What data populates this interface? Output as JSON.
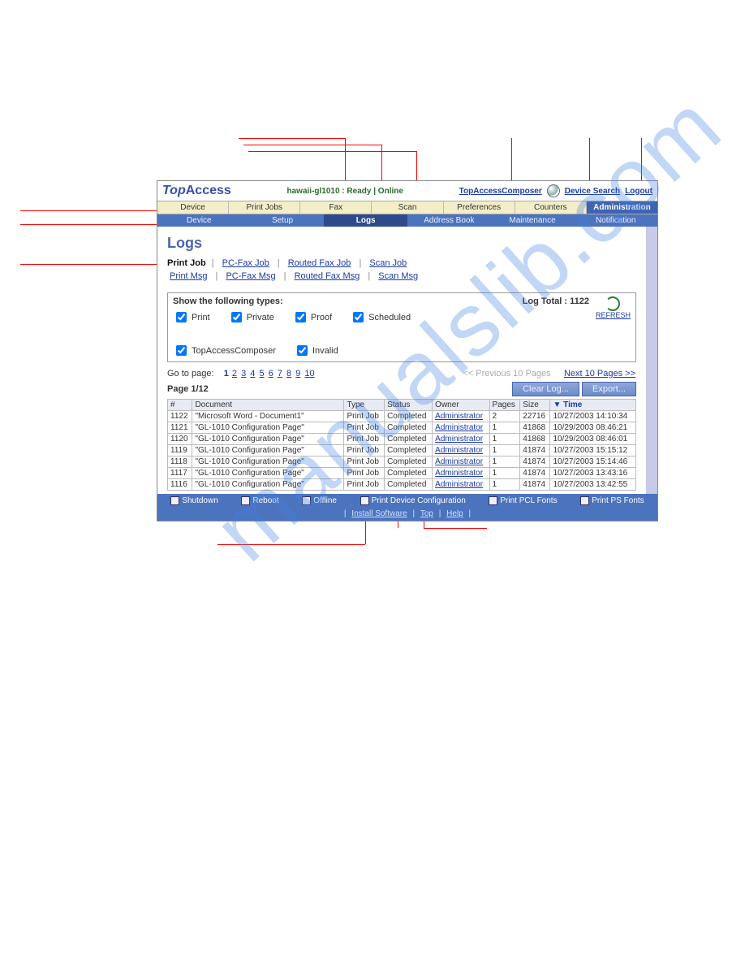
{
  "header": {
    "logo_prefix": "Top",
    "logo_suffix": "Access",
    "device_status": "hawaii-gl1010 : Ready | Online",
    "composer_link": "TopAccessComposer",
    "device_search": "Device Search",
    "logout": "Logout"
  },
  "main_tabs": [
    "Device",
    "Print Jobs",
    "Fax",
    "Scan",
    "Preferences",
    "Counters",
    "Administration"
  ],
  "sub_tabs": [
    "Device",
    "Setup",
    "Logs",
    "Address Book",
    "Maintenance",
    "Notification"
  ],
  "page_title": "Logs",
  "job_links": {
    "current": "Print Job",
    "others": [
      "PC-Fax Job",
      "Routed Fax Job",
      "Scan Job"
    ]
  },
  "msg_links": [
    "Print Msg",
    "PC-Fax Msg",
    "Routed Fax Msg",
    "Scan Msg"
  ],
  "filter": {
    "title": "Show the following types:",
    "options": [
      "Print",
      "Private",
      "Proof",
      "Scheduled",
      "TopAccessComposer",
      "Invalid"
    ],
    "total_label": "Log Total :",
    "total_value": "1122",
    "refresh": "REFRESH"
  },
  "pager": {
    "goto": "Go to page:",
    "pages": [
      "1",
      "2",
      "3",
      "4",
      "5",
      "6",
      "7",
      "8",
      "9",
      "10"
    ],
    "prev": "<< Previous 10 Pages",
    "next": "Next 10 Pages >>",
    "indicator": "Page 1/12",
    "clear": "Clear Log...",
    "export": "Export..."
  },
  "table": {
    "headers": [
      "#",
      "Document",
      "Type",
      "Status",
      "Owner",
      "Pages",
      "Size",
      "▼ Time"
    ],
    "rows": [
      {
        "n": "1122",
        "doc": "\"Microsoft Word - Document1\"",
        "type": "Print Job",
        "status": "Completed",
        "owner": "Administrator",
        "pages": "2",
        "size": "22716",
        "time": "10/27/2003 14:10:34"
      },
      {
        "n": "1121",
        "doc": "\"GL-1010 Configuration Page\"",
        "type": "Print Job",
        "status": "Completed",
        "owner": "Administrator",
        "pages": "1",
        "size": "41868",
        "time": "10/29/2003 08:46:21"
      },
      {
        "n": "1120",
        "doc": "\"GL-1010 Configuration Page\"",
        "type": "Print Job",
        "status": "Completed",
        "owner": "Administrator",
        "pages": "1",
        "size": "41868",
        "time": "10/29/2003 08:46:01"
      },
      {
        "n": "1119",
        "doc": "\"GL-1010 Configuration Page\"",
        "type": "Print Job",
        "status": "Completed",
        "owner": "Administrator",
        "pages": "1",
        "size": "41874",
        "time": "10/27/2003 15:15:12"
      },
      {
        "n": "1118",
        "doc": "\"GL-1010 Configuration Page\"",
        "type": "Print Job",
        "status": "Completed",
        "owner": "Administrator",
        "pages": "1",
        "size": "41874",
        "time": "10/27/2003 15:14:46"
      },
      {
        "n": "1117",
        "doc": "\"GL-1010 Configuration Page\"",
        "type": "Print Job",
        "status": "Completed",
        "owner": "Administrator",
        "pages": "1",
        "size": "41874",
        "time": "10/27/2003 13:43:16"
      },
      {
        "n": "1116",
        "doc": "\"GL-1010 Configuration Page\"",
        "type": "Print Job",
        "status": "Completed",
        "owner": "Administrator",
        "pages": "1",
        "size": "41874",
        "time": "10/27/2003 13:42:55"
      }
    ]
  },
  "footer": {
    "buttons": [
      "Shutdown",
      "Reboot",
      "Offline",
      "Print Device Configuration",
      "Print PCL Fonts",
      "Print PS Fonts"
    ],
    "links": [
      "Install Software",
      "Top",
      "Help"
    ]
  },
  "watermark": "manualslib.com"
}
